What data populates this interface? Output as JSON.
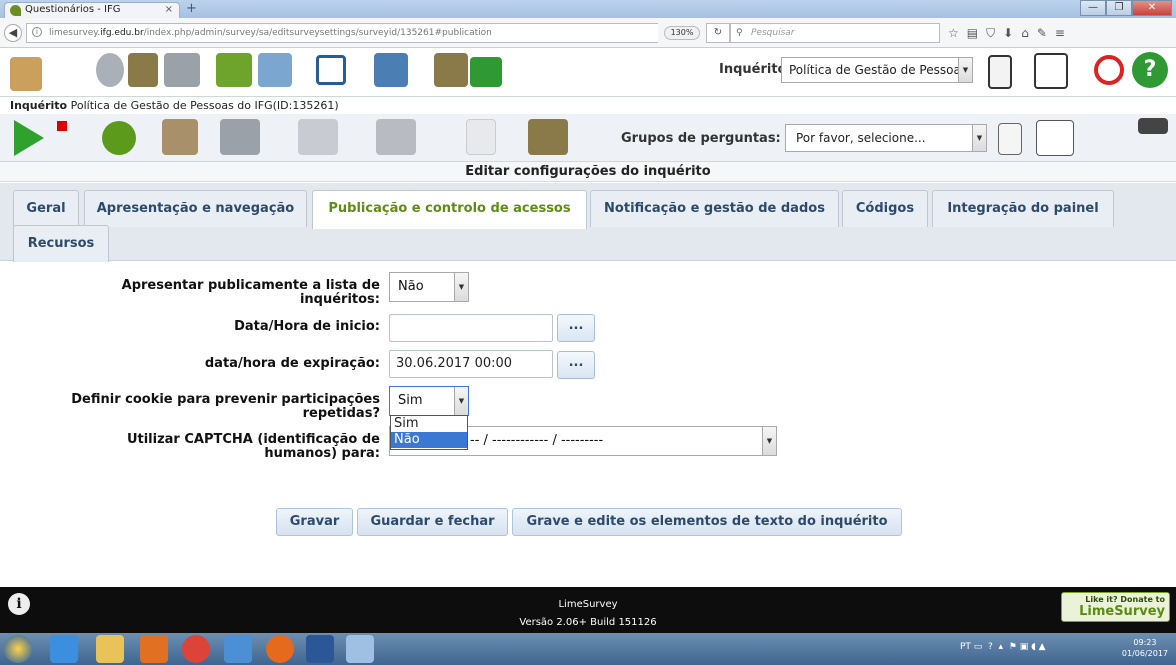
{
  "browser": {
    "tab_title": "Questionários - IFG",
    "url_prefix": "limesurvey.",
    "url_domain": "ifg.edu.br",
    "url_path": "/index.php/admin/survey/sa/editsurveysettings/surveyid/135261#publication",
    "zoom": "130%",
    "search_placeholder": "Pesquisar"
  },
  "app": {
    "inqueritos_label": "Inquéritos:",
    "inqueritos_value": "Política de Gestão de Pessoa",
    "survey_prefix": "Inquérito",
    "survey_title": "Política de Gestão de Pessoas do IFG(ID:135261)",
    "groups_label": "Grupos de perguntas:",
    "groups_value": "Por favor, selecione...",
    "section_title": "Editar configurações do inquérito"
  },
  "tabs": [
    {
      "label": "Geral"
    },
    {
      "label": "Apresentação e navegação"
    },
    {
      "label": "Publicação e controlo de acessos"
    },
    {
      "label": "Notificação e gestão de dados"
    },
    {
      "label": "Códigos"
    },
    {
      "label": "Integração do painel"
    },
    {
      "label": "Recursos"
    }
  ],
  "form": {
    "public_list_label": "Apresentar publicamente a lista de inquéritos:",
    "public_list_value": "Não",
    "start_label": "Data/Hora de inicio:",
    "start_value": "",
    "expiry_label": "data/hora de expiração:",
    "expiry_value": "30.06.2017 00:00",
    "cookie_label": "Definir cookie para prevenir participações repetidas?",
    "cookie_value": "Sim",
    "cookie_options": [
      "Sim",
      "Não"
    ],
    "captcha_label": "Utilizar CAPTCHA (identificação de humanos) para:",
    "captcha_value": "-- / ------------ / ---------",
    "picker_label": "..."
  },
  "buttons": {
    "save": "Gravar",
    "save_close": "Guardar e fechar",
    "save_edit_text": "Grave e edite os elementos de texto do inquérito"
  },
  "footer": {
    "app_name": "LimeSurvey",
    "version": "Versão 2.06+ Build 151126",
    "donate_line1": "Like it? Donate to",
    "donate_line2": "LimeSurvey"
  },
  "taskbar": {
    "lang": "PT",
    "time": "09:23",
    "date": "01/06/2017"
  }
}
